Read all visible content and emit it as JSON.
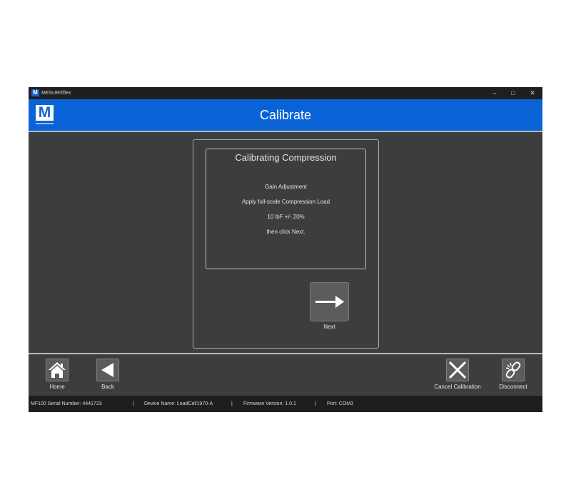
{
  "titlebar": {
    "logo_letter": "M",
    "app_name": "MESUR®flex",
    "minimize": "–",
    "maximize": "□",
    "close": "✕"
  },
  "header": {
    "logo_letter": "M",
    "title": "Calibrate"
  },
  "panel": {
    "heading": "Calibrating Compression",
    "lines": [
      "Gain Adjustment",
      "Apply full-scale Compression Load",
      "10 lbF   +/- 20%",
      "then click Next."
    ]
  },
  "next": {
    "label": "Next",
    "icon": "arrow-right-icon"
  },
  "toolbar": {
    "home_label": "Home",
    "back_label": "Back",
    "cancel_label": "Cancel Calibration",
    "disconnect_label": "Disconnect"
  },
  "status": {
    "serial": "MF100 Serial Number: 4441723",
    "sep1": "|",
    "device": "Device Name: LoadCell1970-A",
    "sep2": "|",
    "firmware": "Firmware Version: 1.0.1",
    "sep3": "|",
    "port": "Port: COM3"
  },
  "colors": {
    "header_blue": "#0a63d6",
    "background": "#3c3d3f",
    "statusbar": "#1e1e1e"
  }
}
